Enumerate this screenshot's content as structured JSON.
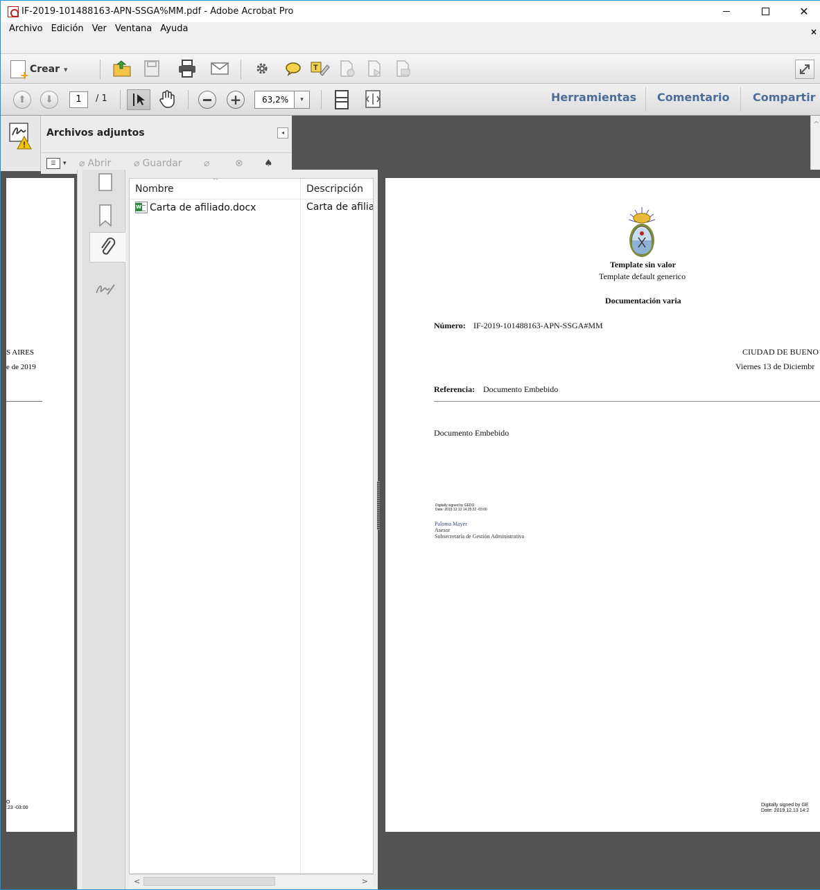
{
  "window": {
    "title": "IF-2019-101488163-APN-SSGA%MM.pdf - Adobe Acrobat Pro",
    "minimize": "–",
    "maximize": "☐",
    "close": "✕"
  },
  "menu": {
    "items": [
      "Archivo",
      "Edición",
      "Ver",
      "Ventana",
      "Ayuda"
    ],
    "close_glyph": "×"
  },
  "toolbar1": {
    "crear_label": "Crear",
    "crear_caret": "▾"
  },
  "toolbar2": {
    "page_current": "1",
    "page_total": "/ 1",
    "zoom_value": "63,2%",
    "zoom_caret": "▾"
  },
  "right_tabs": {
    "tools": "Herramientas",
    "comment": "Comentario",
    "share": "Compartir"
  },
  "attachments_panel": {
    "title": "Archivos adjuntos",
    "collapse_glyph": "◂",
    "tools": {
      "open": "Abrir",
      "save": "Guardar"
    },
    "columns": {
      "name": "Nombre",
      "description": "Descripción"
    },
    "rows": [
      {
        "name": "Carta de afiliado.docx",
        "description": "Carta de afiliado"
      }
    ]
  },
  "left_page": {
    "line1": "S AIRES",
    "line2": "e de 2019",
    "sig1": "O",
    "sig2": ":23 -03:00"
  },
  "main_page": {
    "header1": "Template sin valor",
    "header2": "Template default generico",
    "doc_type": "Documentación varia",
    "numero_label": "Número:",
    "numero_value": "IF-2019-101488163-APN-SSGA#MM",
    "city": "CIUDAD DE BUENO",
    "date": "Viernes 13 de Diciembr",
    "ref_label": "Referencia:",
    "ref_value": "Documento Embebido",
    "body": "Documento Embebido",
    "digital_sig1": "Digitally signed by GEDO",
    "digital_sig2": "Date: 2019.12.13 14:25:22 -03:00",
    "signer_name": "Paloma Mayer",
    "signer_role": "Asesor",
    "signer_org": "Subsecretaría de Gestión Administrativa",
    "footer_sig1": "Digitally signed by GE",
    "footer_sig2": "Date: 2019.12.13 14:2"
  }
}
